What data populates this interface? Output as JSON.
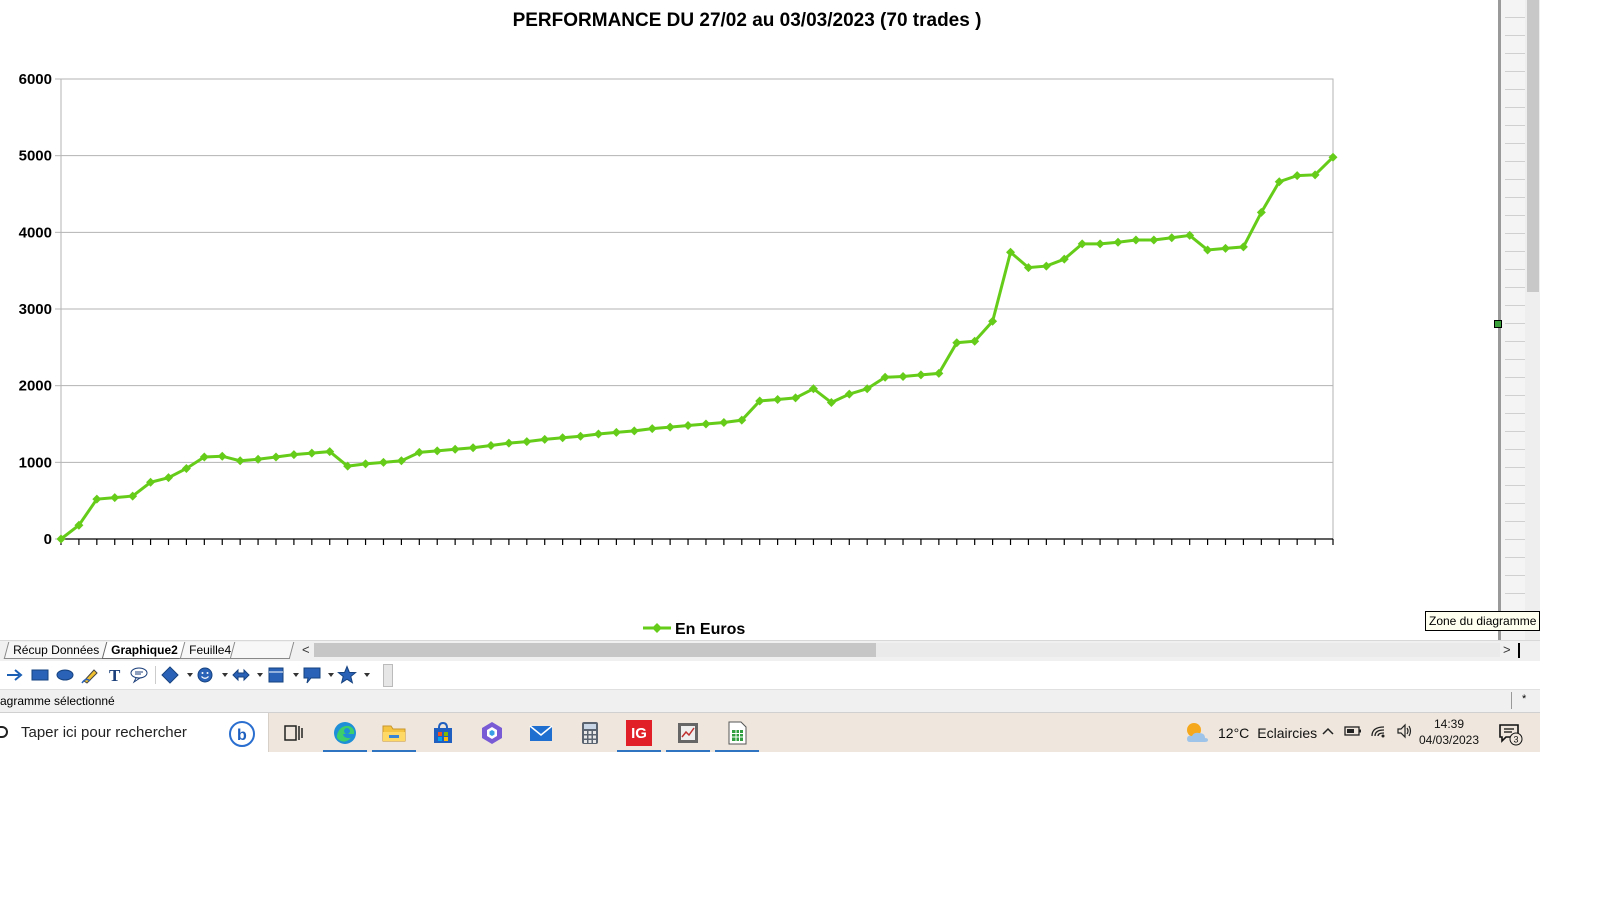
{
  "chart_data": {
    "type": "line",
    "title": "PERFORMANCE DU 27/02 au 03/03/2023 (70 trades )",
    "xlabel": "",
    "ylabel": "",
    "ylim": [
      0,
      6000
    ],
    "yticks": [
      0,
      1000,
      2000,
      3000,
      4000,
      5000,
      6000
    ],
    "grid": "horizontal",
    "legend_position": "bottom-center",
    "series": [
      {
        "name": "En Euros",
        "color": "#66cc1a",
        "marker": "diamond",
        "values": [
          0,
          180,
          520,
          540,
          560,
          740,
          800,
          920,
          1070,
          1080,
          1020,
          1040,
          1070,
          1100,
          1120,
          1140,
          950,
          980,
          1000,
          1020,
          1130,
          1150,
          1170,
          1190,
          1220,
          1250,
          1270,
          1300,
          1320,
          1340,
          1370,
          1390,
          1410,
          1440,
          1460,
          1480,
          1500,
          1520,
          1550,
          1800,
          1820,
          1840,
          1960,
          1780,
          1890,
          1960,
          2110,
          2120,
          2140,
          2160,
          2560,
          2580,
          2840,
          3740,
          3540,
          3560,
          3650,
          3850,
          3850,
          3870,
          3900,
          3900,
          3930,
          3960,
          3770,
          3790,
          3810,
          4260,
          4660,
          4740,
          4750,
          4980
        ]
      }
    ]
  },
  "tooltip": "Zone du diagramme",
  "sheet_tabs": [
    "Récup Données",
    "Graphique2",
    "Feuille4"
  ],
  "active_tab": "Graphique2",
  "nav_left": "<",
  "nav_right": ">",
  "status": {
    "text": "agramme sélectionné",
    "modified": "*"
  },
  "taskbar": {
    "search_placeholder": "Taper ici pour rechercher",
    "weather_temp": "12°C",
    "weather_desc": "Eclaircies",
    "time": "14:39",
    "date": "04/03/2023",
    "notifications": "3",
    "ig_label": "IG"
  }
}
